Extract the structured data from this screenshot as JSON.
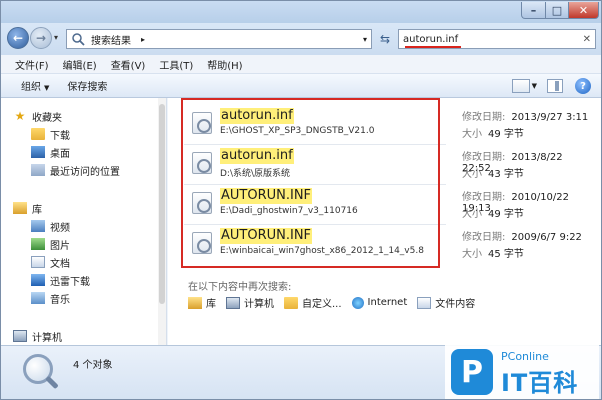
{
  "window": {
    "controls": {
      "minimize": "–",
      "maximize": "□",
      "close": "✕"
    }
  },
  "address": {
    "back_icon": "←",
    "forward_icon": "→",
    "dropdown_icon": "▾",
    "path": "搜索结果",
    "crumb_arrow": "▸",
    "refresh_icon": "⇆",
    "search_value": "autorun.inf",
    "search_clear": "✕"
  },
  "menu": {
    "items": [
      "文件(F)",
      "编辑(E)",
      "查看(V)",
      "工具(T)",
      "帮助(H)"
    ]
  },
  "commands": {
    "organize": "组织",
    "organize_caret": "▼",
    "save_search": "保存搜索",
    "view_caret": "▼",
    "help": "?"
  },
  "nav": {
    "favorites": "收藏夹",
    "favorites_icon": "★",
    "downloads": "下载",
    "desktop": "桌面",
    "recent": "最近访问的位置",
    "libraries": "库",
    "videos": "视频",
    "pictures": "图片",
    "documents": "文档",
    "thunder": "迅雷下载",
    "music": "音乐",
    "computer": "计算机"
  },
  "results": [
    {
      "name": "autorun.inf",
      "path": "E:\\GHOST_XP_SP3_DNGSTB_V21.0",
      "modified_label": "修改日期:",
      "modified": "2013/9/27 3:11",
      "size_label": "大小",
      "size": "49 字节"
    },
    {
      "name": "autorun.inf",
      "path": "D:\\系统\\原版系统",
      "modified_label": "修改日期:",
      "modified": "2013/8/22 22:52",
      "size_label": "大小",
      "size": "43 字节"
    },
    {
      "name": "AUTORUN.INF",
      "path": "E:\\Dadi_ghostwin7_v3_110716",
      "modified_label": "修改日期:",
      "modified": "2010/10/22 19:13",
      "size_label": "大小",
      "size": "49 字节"
    },
    {
      "name": "AUTORUN.INF",
      "path": "E:\\winbaicai_win7ghost_x86_2012_1_14_v5.8",
      "modified_label": "修改日期:",
      "modified": "2009/6/7 9:22",
      "size_label": "大小",
      "size": "45 字节"
    }
  ],
  "search_again": {
    "label": "在以下内容中再次搜索:",
    "items": [
      "库",
      "计算机",
      "自定义...",
      "Internet",
      "文件内容"
    ]
  },
  "status": {
    "count": "4 个对象"
  },
  "watermark": {
    "logo": "P",
    "brand": "PConline",
    "name": "IT百科"
  },
  "colors": {
    "highlight_box": "#d62a24",
    "match_highlight": "#ffef7a",
    "brand_blue": "#1f8ad8"
  }
}
